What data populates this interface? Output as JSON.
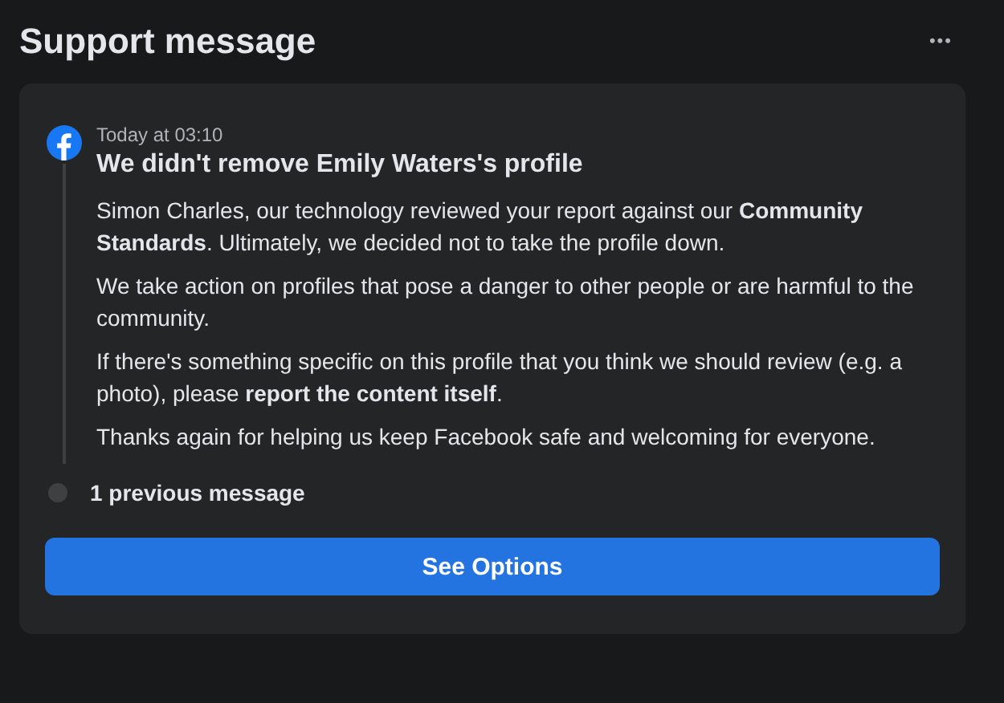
{
  "page": {
    "title": "Support message",
    "more": "•••"
  },
  "message": {
    "time": "Today at 03:10",
    "heading": "We didn't remove Emily Waters's profile",
    "paragraphs": [
      "Simon Charles, our technology reviewed your report against our **Community Standards**. Ultimately, we decided not to take the profile down.",
      "We take action on profiles that pose a danger to other people or are harmful to the community.",
      "If there's something specific on this profile that you think we should review (e.g. a photo), please **report the content itself**.",
      "Thanks again for helping us keep Facebook safe and welcoming for everyone."
    ]
  },
  "previous": {
    "label": "1 previous message"
  },
  "button": {
    "label": "See Options"
  }
}
